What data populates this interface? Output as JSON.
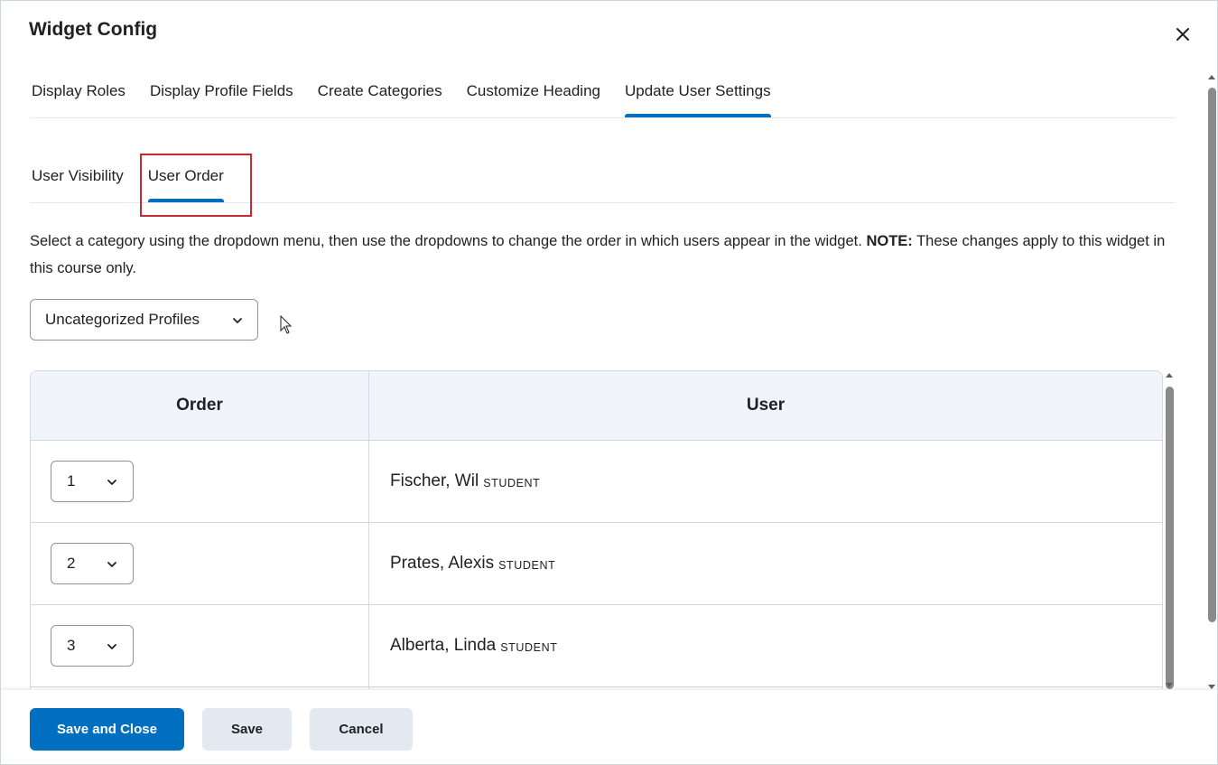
{
  "dialog": {
    "title": "Widget Config",
    "close_label": "Close"
  },
  "tabs": [
    {
      "label": "Display Roles",
      "active": false
    },
    {
      "label": "Display Profile Fields",
      "active": false
    },
    {
      "label": "Create Categories",
      "active": false
    },
    {
      "label": "Customize Heading",
      "active": false
    },
    {
      "label": "Update User Settings",
      "active": true
    }
  ],
  "subtabs": [
    {
      "label": "User Visibility",
      "active": false
    },
    {
      "label": "User Order",
      "active": true
    }
  ],
  "description": {
    "text": "Select a category using the dropdown menu, then use the dropdowns to change the order in which users appear in the widget.",
    "note_label": "NOTE:",
    "note_text": "These changes apply to this widget in this course only."
  },
  "category_select": {
    "value": "Uncategorized Profiles"
  },
  "table": {
    "headers": {
      "order": "Order",
      "user": "User"
    },
    "rows": [
      {
        "order": "1",
        "name": "Fischer, Wil",
        "role": "STUDENT"
      },
      {
        "order": "2",
        "name": "Prates, Alexis",
        "role": "STUDENT"
      },
      {
        "order": "3",
        "name": "Alberta, Linda",
        "role": "STUDENT"
      }
    ]
  },
  "footer": {
    "save_close_label": "Save and Close",
    "save_label": "Save",
    "cancel_label": "Cancel"
  },
  "colors": {
    "accent": "#006fbf",
    "highlight": "#c8292e",
    "header_bg": "#f1f5fb",
    "secondary_btn": "#e3e9f1"
  }
}
